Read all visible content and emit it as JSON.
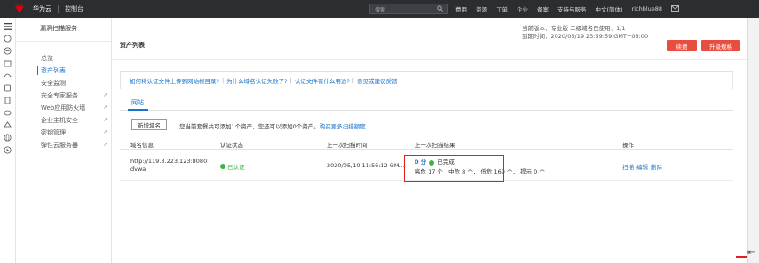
{
  "topbar": {
    "brand": "华为云",
    "console": "控制台",
    "search_placeholder": "搜索",
    "nav": [
      "费用",
      "资源",
      "工单",
      "企业",
      "备案",
      "支持与服务",
      "中文(简体)",
      "richblue88"
    ]
  },
  "side": {
    "title": "漏洞扫描服务",
    "items": [
      {
        "label": "总览"
      },
      {
        "label": "资产列表"
      },
      {
        "label": "安全监测"
      },
      {
        "label": "安全专家服务"
      },
      {
        "label": "Web应用防火墙"
      },
      {
        "label": "企业主机安全"
      },
      {
        "label": "密钥管理"
      },
      {
        "label": "弹性云服务器"
      }
    ]
  },
  "main": {
    "title": "资产列表",
    "version_line1": "当前版本：专业版   二级域名已使用：1/1",
    "version_line2": "到期时间：2020/05/19 23:59:59 GMT+08:00",
    "renew": "续费",
    "upgrade": "升级规格",
    "help_links": [
      "如何将认证文件上传到网站根目录?",
      "为什么域名认证失败了?",
      "认证文件有什么用途?",
      "意见或建议反馈"
    ],
    "help_sep": "|",
    "tab": "网站",
    "add_button": "新增域名",
    "quota_text": "您当前套餐共可添加1个资产，您还可以添加0个资产。",
    "quota_link": "购买更多扫描额度",
    "columns": [
      "域名信息",
      "认证状态",
      "上一次扫描时间",
      "上一次扫描结果",
      "操作"
    ],
    "row": {
      "domain": "http://119.3.223.123:8080",
      "name": "dvwa",
      "status": "已认证",
      "time": "2020/05/10 11:56:12 GM...",
      "score": "0 分",
      "done": "已完成",
      "high": "高危 17 个",
      "medium": "中危 8 个",
      "low": "低危 169 个",
      "hint": "提示 0 个",
      "ops": [
        "扫描",
        "编辑",
        "删除"
      ]
    }
  },
  "colors": {
    "accent": "#1a73c9",
    "danger": "#e84e40",
    "success": "#3eb345"
  }
}
